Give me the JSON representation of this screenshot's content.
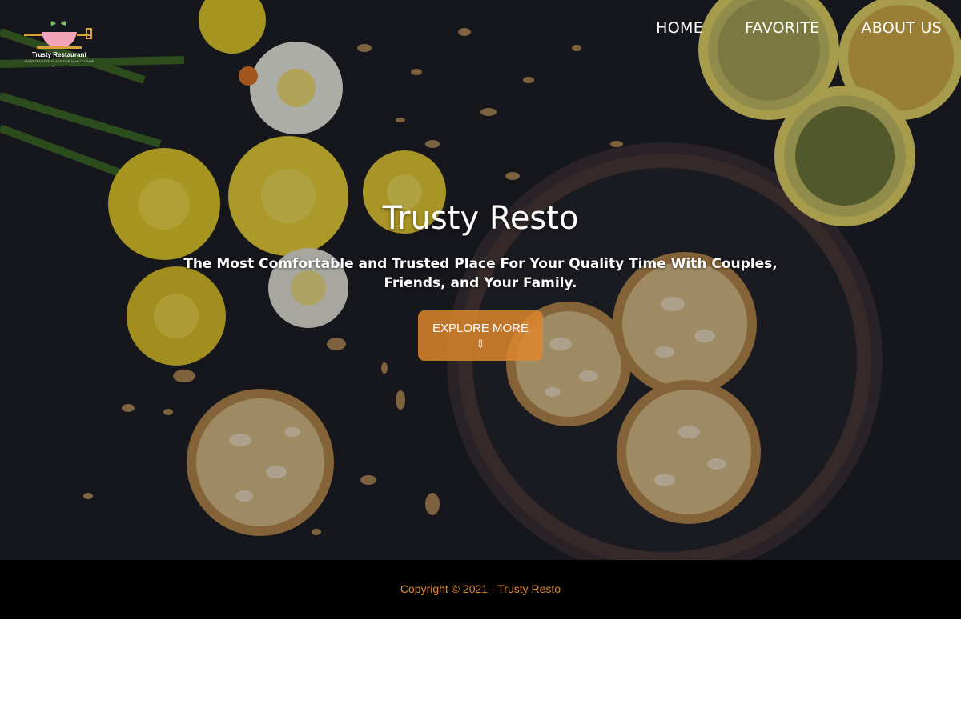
{
  "logo": {
    "name": "Trusty Restaurant",
    "tagline": "YOUR TRUSTED PLACE FOR QUALITY TIME"
  },
  "nav": {
    "items": [
      {
        "label": "HOME"
      },
      {
        "label": "FAVORITE"
      },
      {
        "label": "ABOUT US"
      }
    ]
  },
  "hero": {
    "title": "Trusty Resto",
    "subtitle": "The Most Comfortable and Trusted Place For Your Quality Time With Couples, Friends, and Your Family.",
    "button_label": "EXPLORE MORE",
    "button_icon": "⇩",
    "image_subject": "cookies-flowers-lemons-photo"
  },
  "footer": {
    "copyright": "Copyright © 2021 - Trusty Resto"
  },
  "colors": {
    "accent": "#dd862c",
    "footer_background": "#000000",
    "footer_text": "#e08a2c"
  }
}
